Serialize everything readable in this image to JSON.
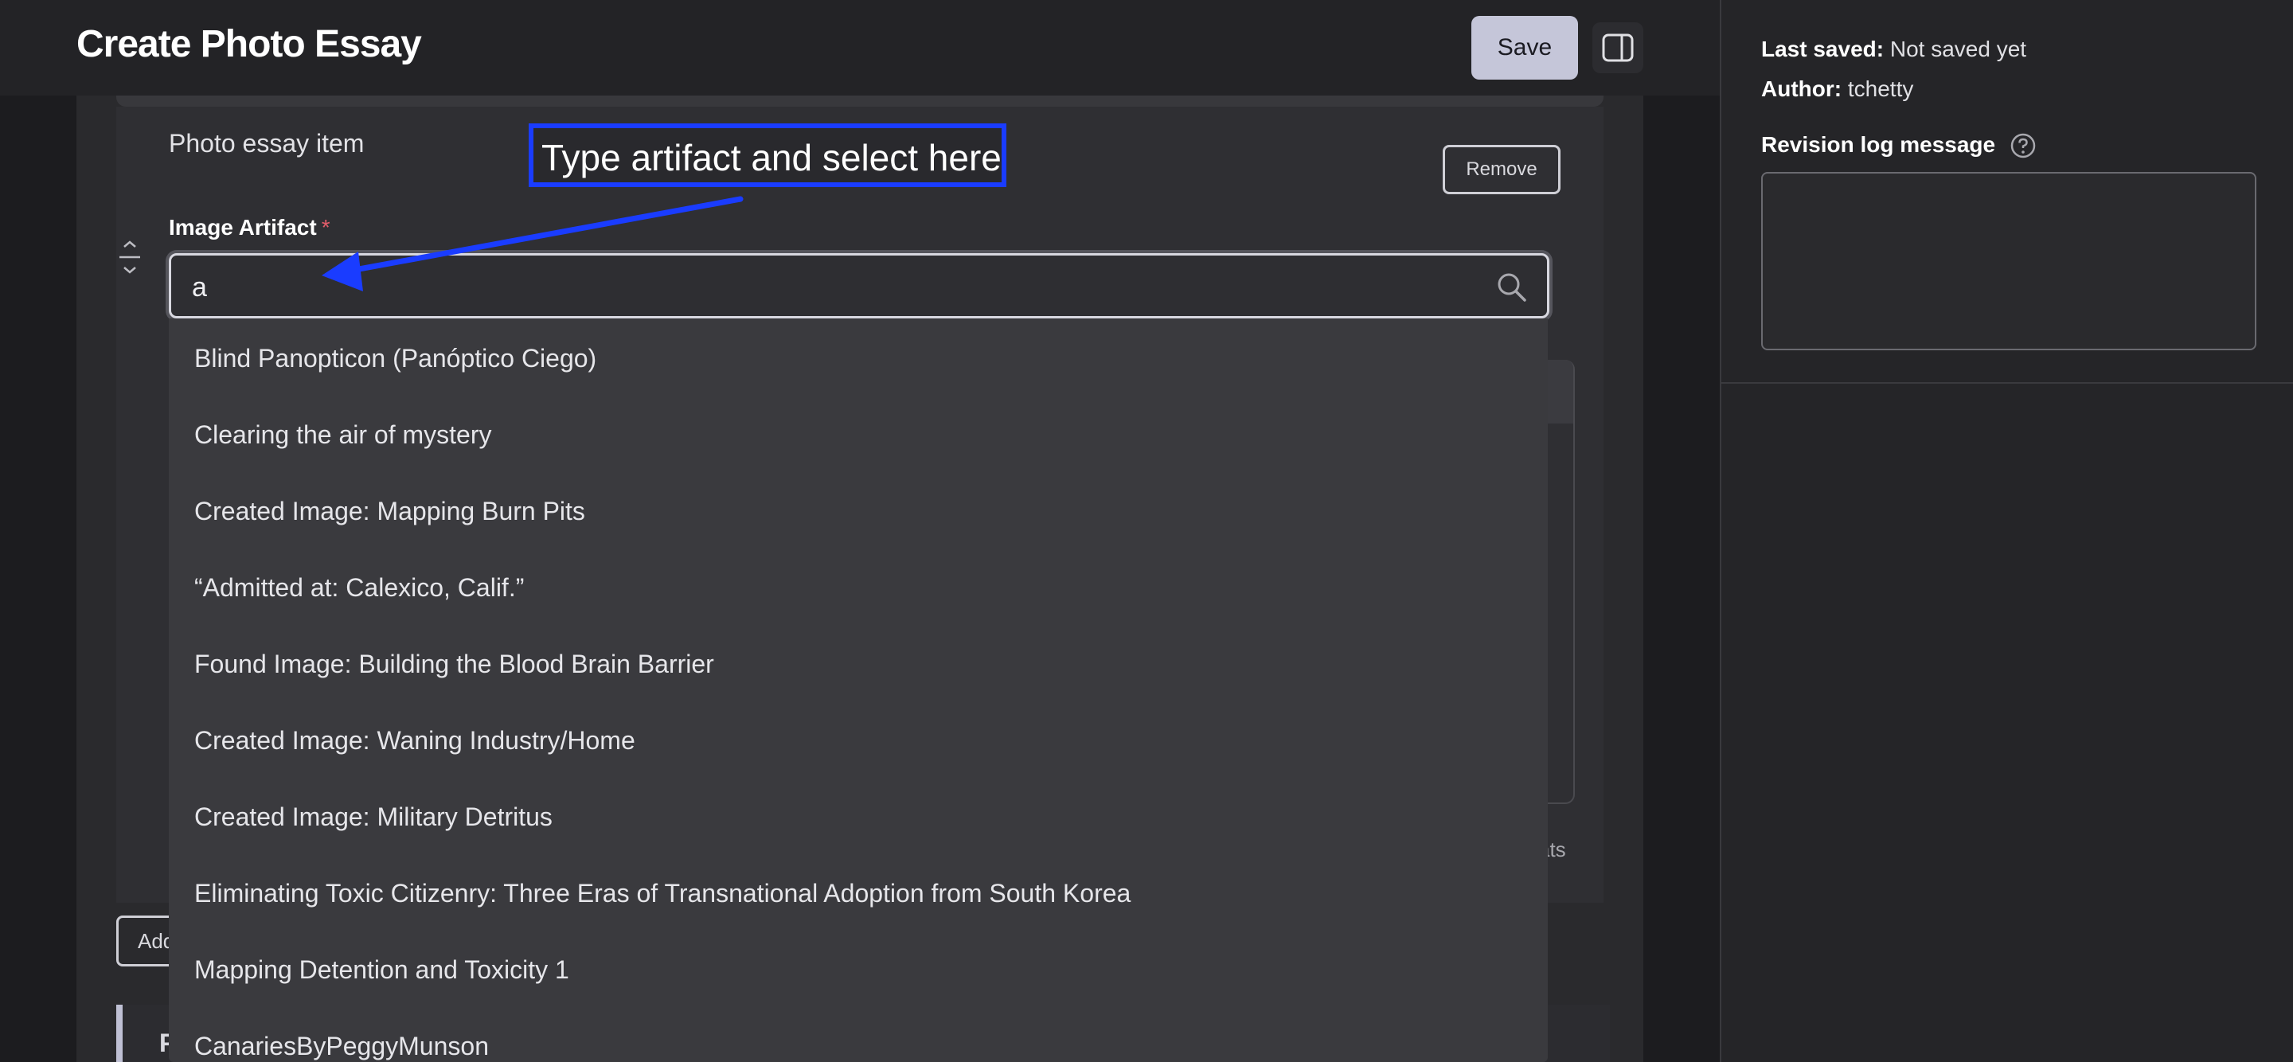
{
  "header": {
    "title": "Create Photo Essay",
    "save_label": "Save",
    "toggle_icon": "sidebar-toggle-icon"
  },
  "item": {
    "title": "Photo essay item",
    "remove_label": "Remove",
    "field_label": "Image Artifact",
    "required_mark": "*",
    "search_value": "a",
    "search_icon": "search-icon"
  },
  "dropdown": {
    "options": [
      "Blind Panopticon (Panóptico Ciego)",
      "Clearing the air of mystery",
      "Created Image: Mapping Burn Pits",
      "“Admitted at: Calexico, Calif.”",
      "Found Image: Building the Blood Brain Barrier",
      "Created Image: Waning Industry/Home",
      "Created Image: Military Detritus",
      "Eliminating Toxic Citizenry: Three Eras of Transnational Adoption from South Korea",
      "Mapping Detention and Toxicity 1",
      "CanariesByPeggyMunson"
    ]
  },
  "background": {
    "formats_fragment": "ats",
    "add_fragment": "Add",
    "next_card_fragment": "P"
  },
  "annotation": {
    "text": "Type artifact and select here",
    "color": "#1a3cff"
  },
  "sidebar": {
    "last_saved_label": "Last saved:",
    "last_saved_value": "Not saved yet",
    "author_label": "Author:",
    "author_value": "tchetty",
    "revision_label": "Revision log message",
    "revision_value": ""
  },
  "colors": {
    "save_button": "#c5c6d9",
    "required": "#e25d6a"
  }
}
